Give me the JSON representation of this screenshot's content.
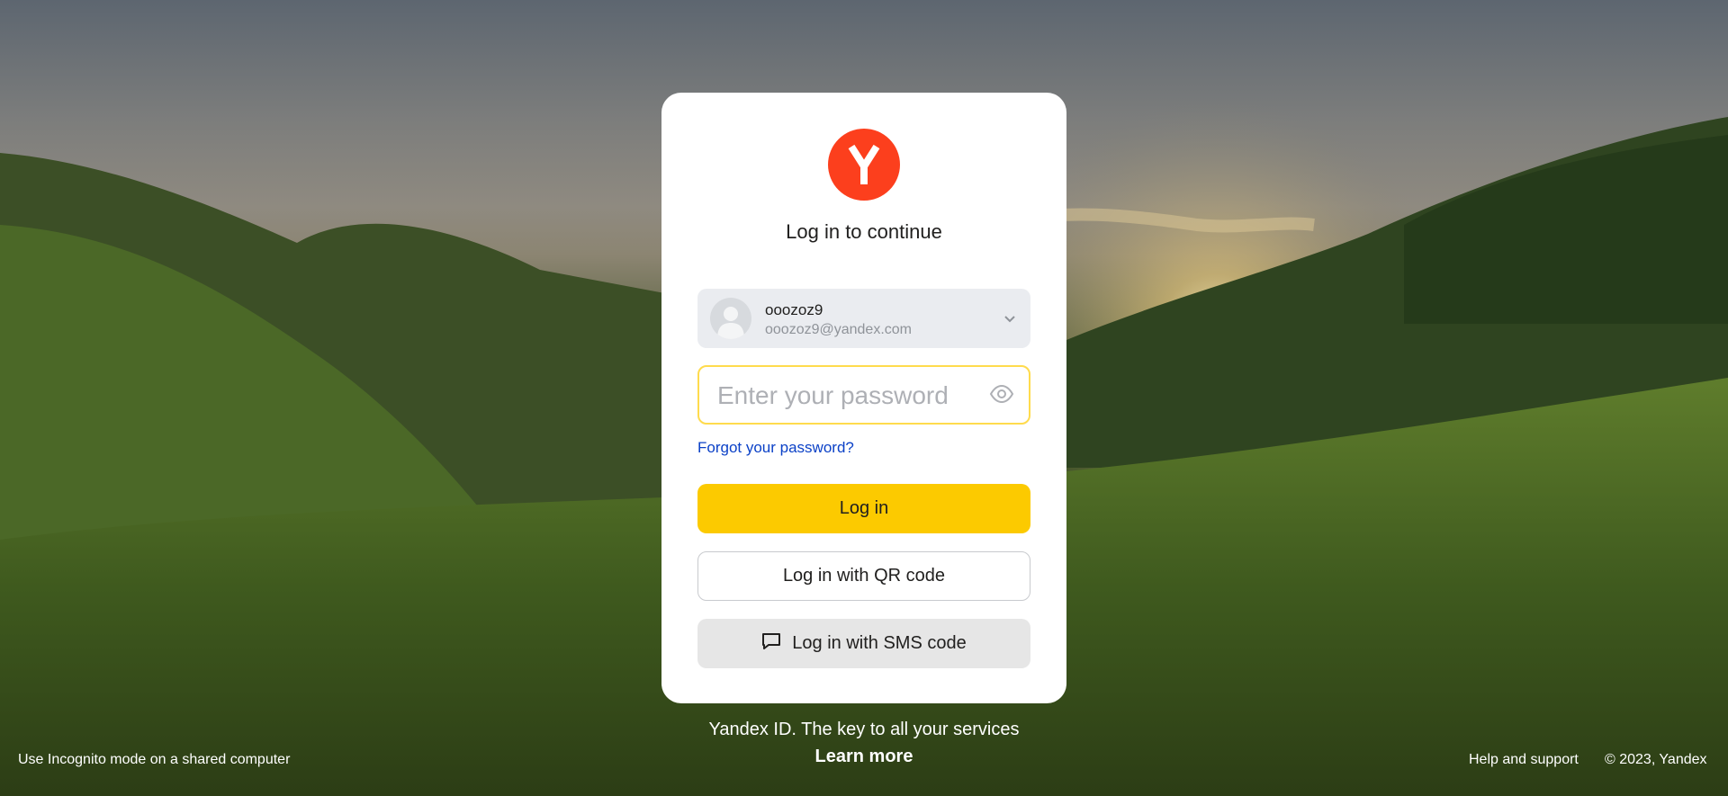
{
  "heading": "Log in to continue",
  "account": {
    "login": "ooozoz9",
    "email": "ooozoz9@yandex.com"
  },
  "password": {
    "placeholder": "Enter your password",
    "value": ""
  },
  "forgot_link": "Forgot your password?",
  "buttons": {
    "login": "Log in",
    "qr": "Log in with QR code",
    "sms": "Log in with SMS code"
  },
  "footer": {
    "tagline": "Yandex ID. The key to all your services",
    "learn_more": "Learn more",
    "incognito": "Use Incognito mode on a shared computer",
    "help": "Help and support",
    "copyright": "© 2023, Yandex"
  },
  "icons": {
    "logo": "yandex-logo-icon",
    "avatar": "user-avatar-icon",
    "dropdown": "chevron-down-icon",
    "show_password": "eye-icon",
    "sms": "chat-bubble-icon"
  },
  "colors": {
    "brand_red": "#fc3f1d",
    "login_button": "#fcca00",
    "focus_border": "#ffdb4d",
    "link": "#0b41c7"
  }
}
